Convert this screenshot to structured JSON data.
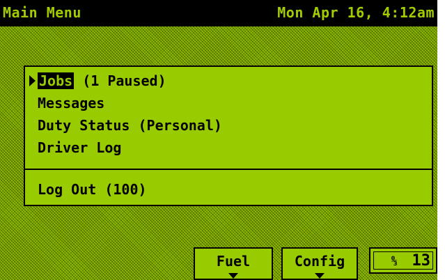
{
  "header": {
    "title": "Main Menu",
    "datetime": "Mon Apr 16, 4:12am"
  },
  "menu": {
    "items": [
      {
        "label": "Jobs",
        "suffix": " (1 Paused)"
      },
      {
        "label": "Messages"
      },
      {
        "label": "Duty Status (Personal)"
      },
      {
        "label": "Driver Log"
      }
    ],
    "logout": "Log Out (100)"
  },
  "softkeys": {
    "fuel": "Fuel",
    "config": "Config",
    "signal_icon": "antenna-signal-icon",
    "signal_value": "13"
  },
  "colors": {
    "screen": "#8fbd00",
    "bar": "#000000",
    "text_on_bar": "#a2cc00"
  }
}
